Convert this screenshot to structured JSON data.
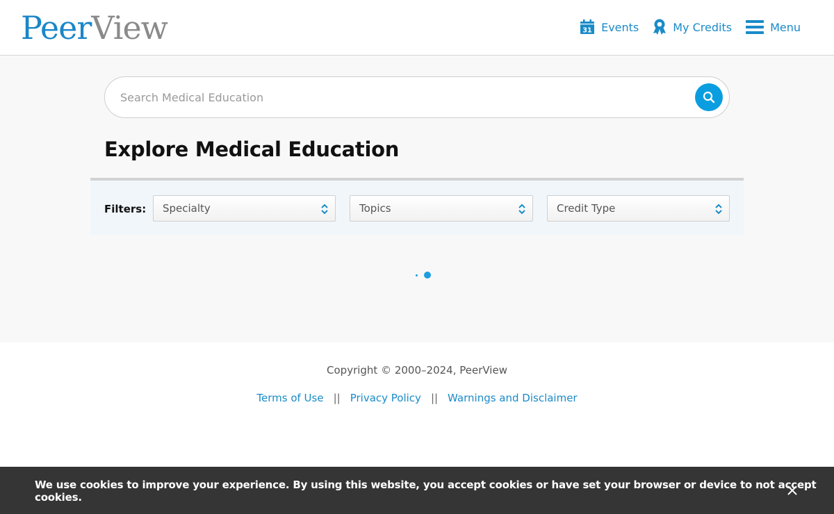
{
  "header": {
    "logo_part1": "Peer",
    "logo_part2": "View",
    "nav": {
      "events_label": "Events",
      "calendar_day": "31",
      "credits_label": "My Credits",
      "menu_label": "Menu"
    }
  },
  "search": {
    "placeholder": "Search Medical Education"
  },
  "main": {
    "title": "Explore Medical Education",
    "filters": {
      "label": "Filters:",
      "selects": [
        {
          "selected": "Specialty"
        },
        {
          "selected": "Topics"
        },
        {
          "selected": "Credit Type"
        }
      ]
    }
  },
  "footer": {
    "copyright": "Copyright © 2000–2024, PeerView",
    "links": [
      "Terms of Use",
      "Privacy Policy",
      "Warnings and Disclaimer"
    ],
    "separator": "||"
  },
  "cookie": {
    "message": "We use cookies to improve your experience. By using this website, you accept cookies or have set your browser or device to not accept cookies."
  },
  "colors": {
    "accent": "#0a9ee0",
    "link": "#1a8bc9",
    "cookie_bg": "#353535"
  },
  "icons": [
    "calendar-icon",
    "award-ribbon-icon",
    "hamburger-menu-icon",
    "search-icon",
    "chevron-updown-icon",
    "close-icon"
  ]
}
